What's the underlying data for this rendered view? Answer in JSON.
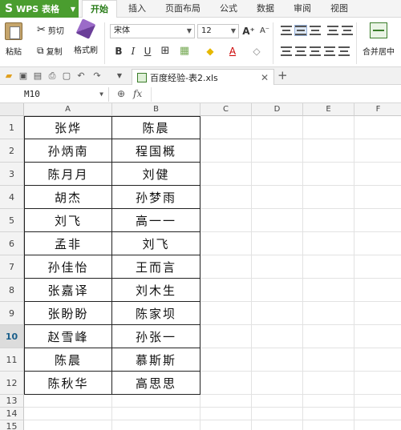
{
  "app": {
    "title": "WPS 表格",
    "logo_glyph": "S"
  },
  "menu": {
    "tabs": [
      "开始",
      "插入",
      "页面布局",
      "公式",
      "数据",
      "审阅",
      "视图"
    ],
    "active": 0
  },
  "ribbon": {
    "paste_label": "粘贴",
    "cut_label": "剪切",
    "copy_label": "复制",
    "format_painter_label": "格式刷",
    "font_name": "宋体",
    "font_size": "12",
    "bold": "B",
    "italic": "I",
    "underline": "U",
    "grow_font": "A⁺",
    "shrink_font": "A⁻",
    "merge_label": "合并居中"
  },
  "doc_tabs": [
    {
      "name": "百度经验-表2.xls"
    }
  ],
  "formula_bar": {
    "name_box": "M10",
    "fx": "fx",
    "formula": ""
  },
  "sheet": {
    "columns": [
      "A",
      "B",
      "C",
      "D",
      "E",
      "F"
    ],
    "rows": [
      {
        "num": "1",
        "a": "张烨",
        "b": "陈晨"
      },
      {
        "num": "2",
        "a": "孙炳南",
        "b": "程国概"
      },
      {
        "num": "3",
        "a": "陈月月",
        "b": "刘健"
      },
      {
        "num": "4",
        "a": "胡杰",
        "b": "孙梦雨"
      },
      {
        "num": "5",
        "a": "刘飞",
        "b": "高一一"
      },
      {
        "num": "6",
        "a": "孟非",
        "b": "刘飞"
      },
      {
        "num": "7",
        "a": "孙佳怡",
        "b": "王而言"
      },
      {
        "num": "8",
        "a": "张嘉译",
        "b": "刘木生"
      },
      {
        "num": "9",
        "a": "张盼盼",
        "b": "陈家坝"
      },
      {
        "num": "10",
        "a": "赵雪峰",
        "b": "孙张一"
      },
      {
        "num": "11",
        "a": "陈晨",
        "b": "慕斯斯"
      },
      {
        "num": "12",
        "a": "陈秋华",
        "b": "高思思"
      }
    ],
    "extra_rows": [
      "13",
      "14",
      "15"
    ],
    "selected_row": "10"
  },
  "colors": {
    "app_green": "#4a9d2f",
    "active_tab_text": "#2a7d1a"
  }
}
